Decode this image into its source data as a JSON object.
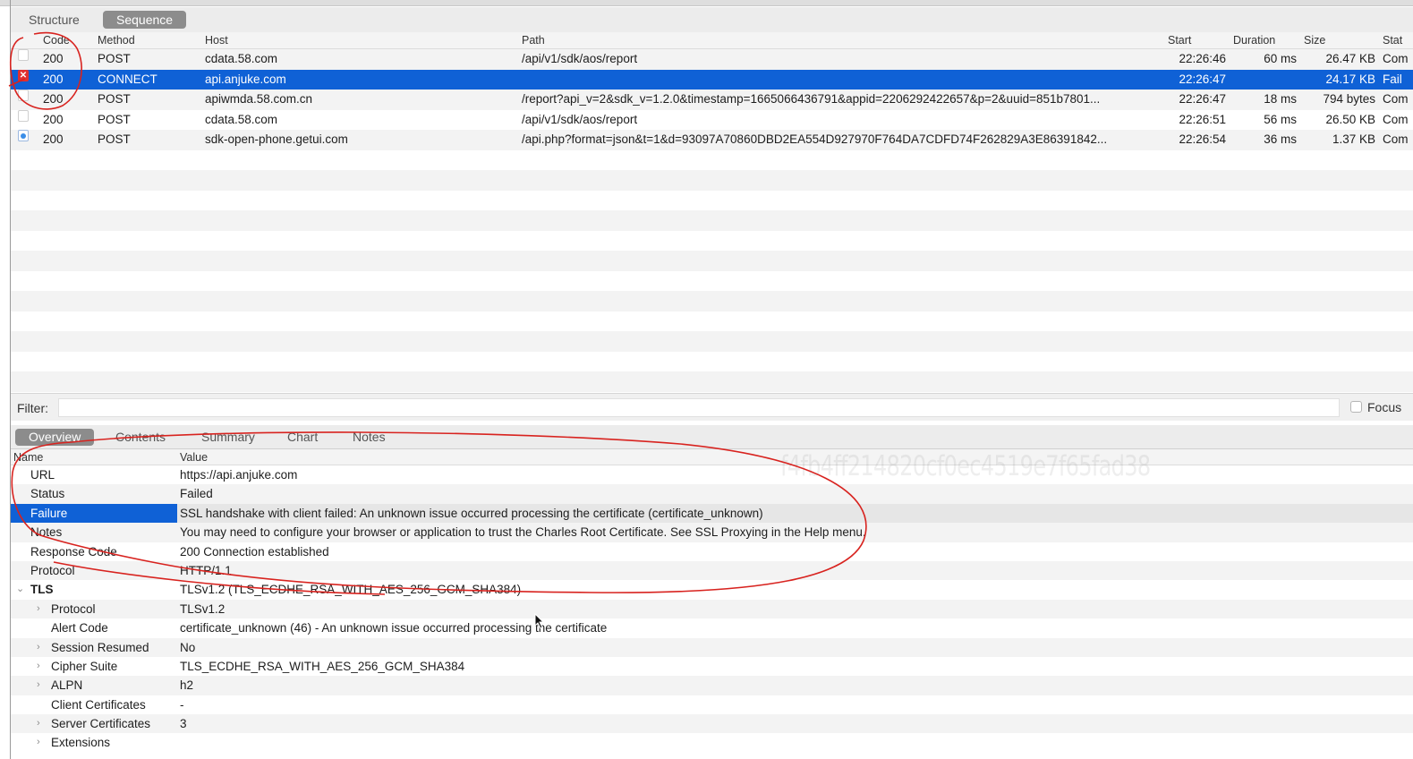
{
  "view_tabs": {
    "structure": "Structure",
    "sequence": "Sequence"
  },
  "sequence_table": {
    "columns": {
      "code": "Code",
      "method": "Method",
      "host": "Host",
      "path": "Path",
      "start": "Start",
      "duration": "Duration",
      "size": "Size",
      "status": "Stat"
    },
    "rows": [
      {
        "icon": "blank-doc-icon",
        "code": "200",
        "method": "POST",
        "host": "cdata.58.com",
        "path": "/api/v1/sdk/aos/report",
        "start": "22:26:46",
        "duration": "60 ms",
        "size": "26.47 KB",
        "status": "Com"
      },
      {
        "icon": "error-icon",
        "icon_glyph": "✕",
        "code": "200",
        "method": "CONNECT",
        "host": "api.anjuke.com",
        "path": "",
        "start": "22:26:47",
        "duration": "",
        "size": "24.17 KB",
        "status": "Fail",
        "selected": true
      },
      {
        "icon": "blank-doc-icon",
        "code": "200",
        "method": "POST",
        "host": "apiwmda.58.com.cn",
        "path": "/report?api_v=2&sdk_v=1.2.0&timestamp=1665066436791&appid=2206292422657&p=2&uuid=851b7801...",
        "start": "22:26:47",
        "duration": "18 ms",
        "size": "794 bytes",
        "status": "Com"
      },
      {
        "icon": "blank-doc-icon",
        "code": "200",
        "method": "POST",
        "host": "cdata.58.com",
        "path": "/api/v1/sdk/aos/report",
        "start": "22:26:51",
        "duration": "56 ms",
        "size": "26.50 KB",
        "status": "Com"
      },
      {
        "icon": "info-icon",
        "code": "200",
        "method": "POST",
        "host": "sdk-open-phone.getui.com",
        "path": "/api.php?format=json&t=1&d=93097A70860DBD2EA554D927970F764DA7CDFD74F262829A3E86391842...",
        "start": "22:26:54",
        "duration": "36 ms",
        "size": "1.37 KB",
        "status": "Com"
      }
    ]
  },
  "filter": {
    "label": "Filter:",
    "value": "",
    "focus_label": "Focus",
    "focus_checked": false
  },
  "detail_tabs": {
    "overview": "Overview",
    "contents": "Contents",
    "summary": "Summary",
    "chart": "Chart",
    "notes": "Notes"
  },
  "overview": {
    "columns": {
      "name": "Name",
      "value": "Value"
    },
    "watermark": "f4fb4ff214820cf0ec4519e7f65fad38",
    "rows": [
      {
        "name": "URL",
        "value": "https://api.anjuke.com"
      },
      {
        "name": "Status",
        "value": "Failed"
      },
      {
        "name": "Failure",
        "value": "SSL handshake with client failed: An unknown issue occurred processing the certificate (certificate_unknown)",
        "selected": true
      },
      {
        "name": "Notes",
        "value": "You may need to configure your browser or application to trust the Charles Root Certificate. See SSL Proxying in the Help menu."
      },
      {
        "name": "Response Code",
        "value": "200 Connection established"
      },
      {
        "name": "Protocol",
        "value": "HTTP/1.1"
      },
      {
        "name": "TLS",
        "value": "TLSv1.2 (TLS_ECDHE_RSA_WITH_AES_256_GCM_SHA384)",
        "expanded": true,
        "bold": true
      },
      {
        "name": "Protocol",
        "value": "TLSv1.2",
        "child": true,
        "expandable": true
      },
      {
        "name": "Alert Code",
        "value": "certificate_unknown (46) - An unknown issue occurred processing the certificate",
        "child": true
      },
      {
        "name": "Session Resumed",
        "value": "No",
        "child": true,
        "expandable": true
      },
      {
        "name": "Cipher Suite",
        "value": "TLS_ECDHE_RSA_WITH_AES_256_GCM_SHA384",
        "child": true,
        "expandable": true
      },
      {
        "name": "ALPN",
        "value": "h2",
        "child": true,
        "expandable": true
      },
      {
        "name": "Client Certificates",
        "value": "-",
        "child": true
      },
      {
        "name": "Server Certificates",
        "value": "3",
        "child": true,
        "expandable": true
      },
      {
        "name": "Extensions",
        "value": "",
        "child": true,
        "expandable": true
      }
    ]
  },
  "colors": {
    "selection_blue": "#0f61d6",
    "annotation_red": "#d8231f",
    "error_red": "#e03030"
  }
}
